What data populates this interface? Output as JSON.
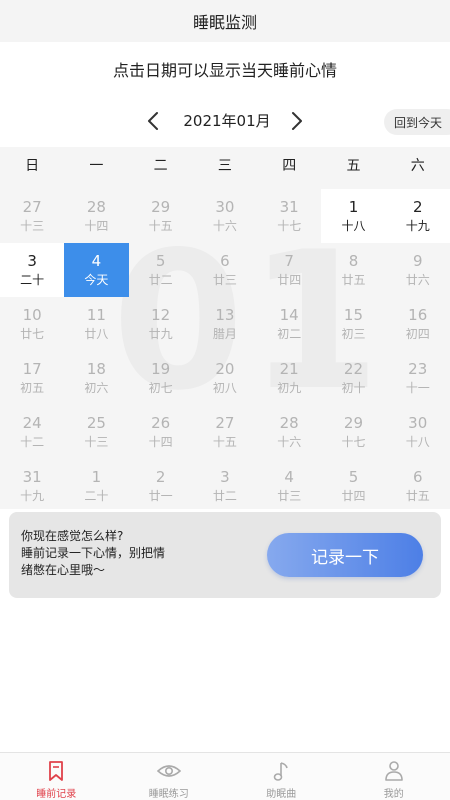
{
  "header": {
    "title": "睡眠监测"
  },
  "hint": "点击日期可以显示当天睡前心情",
  "month_nav": {
    "label": "2021年01月",
    "today_button": "回到今天"
  },
  "calendar": {
    "watermark": "01",
    "weekdays": [
      "日",
      "一",
      "二",
      "三",
      "四",
      "五",
      "六"
    ],
    "weeks": [
      [
        {
          "d": "27",
          "l": "十三",
          "t": "other"
        },
        {
          "d": "28",
          "l": "十四",
          "t": "other"
        },
        {
          "d": "29",
          "l": "十五",
          "t": "other"
        },
        {
          "d": "30",
          "l": "十六",
          "t": "other"
        },
        {
          "d": "31",
          "l": "十七",
          "t": "other"
        },
        {
          "d": "1",
          "l": "十八",
          "t": "cur"
        },
        {
          "d": "2",
          "l": "十九",
          "t": "cur"
        }
      ],
      [
        {
          "d": "3",
          "l": "二十",
          "t": "cur"
        },
        {
          "d": "4",
          "l": "今天",
          "t": "sel"
        },
        {
          "d": "5",
          "l": "廿二",
          "t": "other"
        },
        {
          "d": "6",
          "l": "廿三",
          "t": "other"
        },
        {
          "d": "7",
          "l": "廿四",
          "t": "other"
        },
        {
          "d": "8",
          "l": "廿五",
          "t": "other"
        },
        {
          "d": "9",
          "l": "廿六",
          "t": "other"
        }
      ],
      [
        {
          "d": "10",
          "l": "廿七",
          "t": "other"
        },
        {
          "d": "11",
          "l": "廿八",
          "t": "other"
        },
        {
          "d": "12",
          "l": "廿九",
          "t": "other"
        },
        {
          "d": "13",
          "l": "腊月",
          "t": "other"
        },
        {
          "d": "14",
          "l": "初二",
          "t": "other"
        },
        {
          "d": "15",
          "l": "初三",
          "t": "other"
        },
        {
          "d": "16",
          "l": "初四",
          "t": "other"
        }
      ],
      [
        {
          "d": "17",
          "l": "初五",
          "t": "other"
        },
        {
          "d": "18",
          "l": "初六",
          "t": "other"
        },
        {
          "d": "19",
          "l": "初七",
          "t": "other"
        },
        {
          "d": "20",
          "l": "初八",
          "t": "other"
        },
        {
          "d": "21",
          "l": "初九",
          "t": "other"
        },
        {
          "d": "22",
          "l": "初十",
          "t": "other"
        },
        {
          "d": "23",
          "l": "十一",
          "t": "other"
        }
      ],
      [
        {
          "d": "24",
          "l": "十二",
          "t": "other"
        },
        {
          "d": "25",
          "l": "十三",
          "t": "other"
        },
        {
          "d": "26",
          "l": "十四",
          "t": "other"
        },
        {
          "d": "27",
          "l": "十五",
          "t": "other"
        },
        {
          "d": "28",
          "l": "十六",
          "t": "other"
        },
        {
          "d": "29",
          "l": "十七",
          "t": "other"
        },
        {
          "d": "30",
          "l": "十八",
          "t": "other"
        }
      ],
      [
        {
          "d": "31",
          "l": "十九",
          "t": "other"
        },
        {
          "d": "1",
          "l": "二十",
          "t": "other"
        },
        {
          "d": "2",
          "l": "廿一",
          "t": "other"
        },
        {
          "d": "3",
          "l": "廿二",
          "t": "other"
        },
        {
          "d": "4",
          "l": "廿三",
          "t": "other"
        },
        {
          "d": "5",
          "l": "廿四",
          "t": "other"
        },
        {
          "d": "6",
          "l": "廿五",
          "t": "other"
        }
      ]
    ]
  },
  "mood_card": {
    "lines": [
      "你现在感觉怎么样?",
      "睡前记录一下心情，别把情",
      "绪憋在心里哦～"
    ],
    "button": "记录一下"
  },
  "tabbar": {
    "tabs": [
      {
        "label": "睡前记录",
        "icon": "bookmark-icon",
        "active": true
      },
      {
        "label": "睡眠练习",
        "icon": "eye-icon",
        "active": false
      },
      {
        "label": "助眠曲",
        "icon": "music-note-icon",
        "active": false
      },
      {
        "label": "我的",
        "icon": "person-icon",
        "active": false
      }
    ]
  },
  "colors": {
    "accent": "#3d8eea",
    "active_tab": "#e0424b",
    "button_start": "#86a9ee",
    "button_end": "#4d7fe6"
  }
}
